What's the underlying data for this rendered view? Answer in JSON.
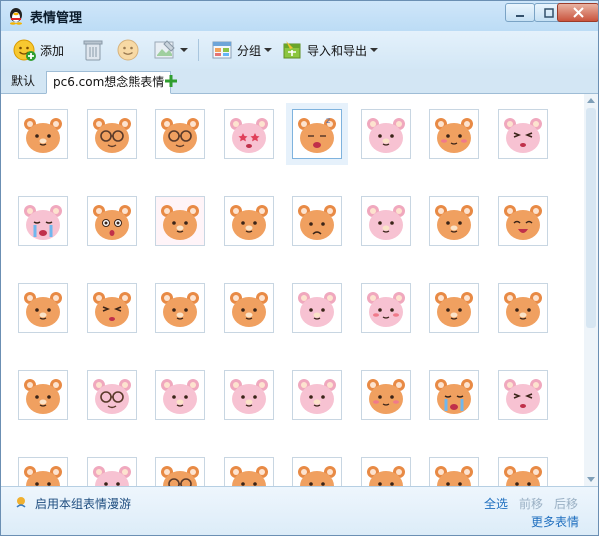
{
  "window": {
    "title": "表情管理",
    "controls": [
      "minimize",
      "maximize",
      "close"
    ]
  },
  "toolbar": {
    "add_label": "添加",
    "group_label": "分组",
    "import_export_label": "导入和导出"
  },
  "tabs": [
    {
      "label": "默认",
      "active": false
    },
    {
      "label": "pc6.com想念熊表情",
      "active": true
    }
  ],
  "grid": {
    "selected_index": 4,
    "items": [
      {
        "name": "bear-smile",
        "tone": "orange",
        "face": "smile"
      },
      {
        "name": "bear-glasses",
        "tone": "orange",
        "face": "glasses"
      },
      {
        "name": "bear-big-glasses",
        "tone": "orange",
        "face": "glasses"
      },
      {
        "name": "pink-bear-star-eyes",
        "tone": "pink",
        "face": "star"
      },
      {
        "name": "bear-sleepy",
        "tone": "orange",
        "face": "sleep"
      },
      {
        "name": "pink-bear-happy",
        "tone": "pink",
        "face": "smile"
      },
      {
        "name": "bear-blush",
        "tone": "orange",
        "face": "blush"
      },
      {
        "name": "pink-bear-wink",
        "tone": "pink",
        "face": "wink"
      },
      {
        "name": "pink-bear-cry",
        "tone": "pink",
        "face": "cry"
      },
      {
        "name": "bear-striped-shock",
        "tone": "orange",
        "face": "shock"
      },
      {
        "name": "bears-hug",
        "tone": "mix",
        "face": "smile"
      },
      {
        "name": "bear-chef",
        "tone": "orange",
        "face": "smile"
      },
      {
        "name": "bear-beanie",
        "tone": "orange",
        "face": "sad"
      },
      {
        "name": "pink-bear-hearts",
        "tone": "pink",
        "face": "smile"
      },
      {
        "name": "bear-flowers",
        "tone": "orange",
        "face": "smile"
      },
      {
        "name": "bear-cheer",
        "tone": "orange",
        "face": "laugh"
      },
      {
        "name": "bear-purple-hat",
        "tone": "orange",
        "face": "smile"
      },
      {
        "name": "bear-wave",
        "tone": "orange",
        "face": "wink"
      },
      {
        "name": "bear-hi",
        "tone": "orange",
        "face": "smile"
      },
      {
        "name": "bear-rainbow",
        "tone": "orange",
        "face": "smile"
      },
      {
        "name": "pink-bear-dance",
        "tone": "pink",
        "face": "smile"
      },
      {
        "name": "pink-bear-msg",
        "tone": "pink",
        "face": "blush"
      },
      {
        "name": "bunny-hat-bear",
        "tone": "orange",
        "face": "smile"
      },
      {
        "name": "blonde-bear",
        "tone": "orange",
        "face": "smile"
      },
      {
        "name": "bear-bucket",
        "tone": "orange",
        "face": "smile"
      },
      {
        "name": "pink-bear-glasses",
        "tone": "pink",
        "face": "glasses"
      },
      {
        "name": "pink-bear-purple",
        "tone": "pink",
        "face": "smile"
      },
      {
        "name": "pink-bear-flower",
        "tone": "pink",
        "face": "smile"
      },
      {
        "name": "pink-bear-cream",
        "tone": "pink",
        "face": "smile"
      },
      {
        "name": "bear-shy",
        "tone": "orange",
        "face": "blush"
      },
      {
        "name": "bear-tears",
        "tone": "orange",
        "face": "cry"
      },
      {
        "name": "pink-bear-dizzy",
        "tone": "pink",
        "face": "wink"
      },
      {
        "name": "bear-partial-1",
        "tone": "orange",
        "face": "smile"
      },
      {
        "name": "pink-bear-partial",
        "tone": "pink",
        "face": "smile"
      },
      {
        "name": "bear-partial-2",
        "tone": "orange",
        "face": "glasses"
      },
      {
        "name": "bear-partial-3",
        "tone": "orange",
        "face": "smile"
      },
      {
        "name": "bear-partial-4",
        "tone": "orange",
        "face": "smile"
      },
      {
        "name": "bear-partial-5",
        "tone": "orange",
        "face": "smile"
      },
      {
        "name": "bear-partial-6",
        "tone": "orange",
        "face": "smile"
      },
      {
        "name": "bear-partial-7",
        "tone": "orange",
        "face": "smile"
      }
    ]
  },
  "bottom": {
    "roam_label": "启用本组表情漫游",
    "select_all_label": "全选",
    "move_forward_label": "前移",
    "move_back_label": "后移",
    "more_label": "更多表情"
  },
  "colors": {
    "orange_bear": "#f0a060",
    "pink_bear": "#f7c2d2",
    "link": "#1f6fbf",
    "disabled_link": "#9ab0c4"
  }
}
